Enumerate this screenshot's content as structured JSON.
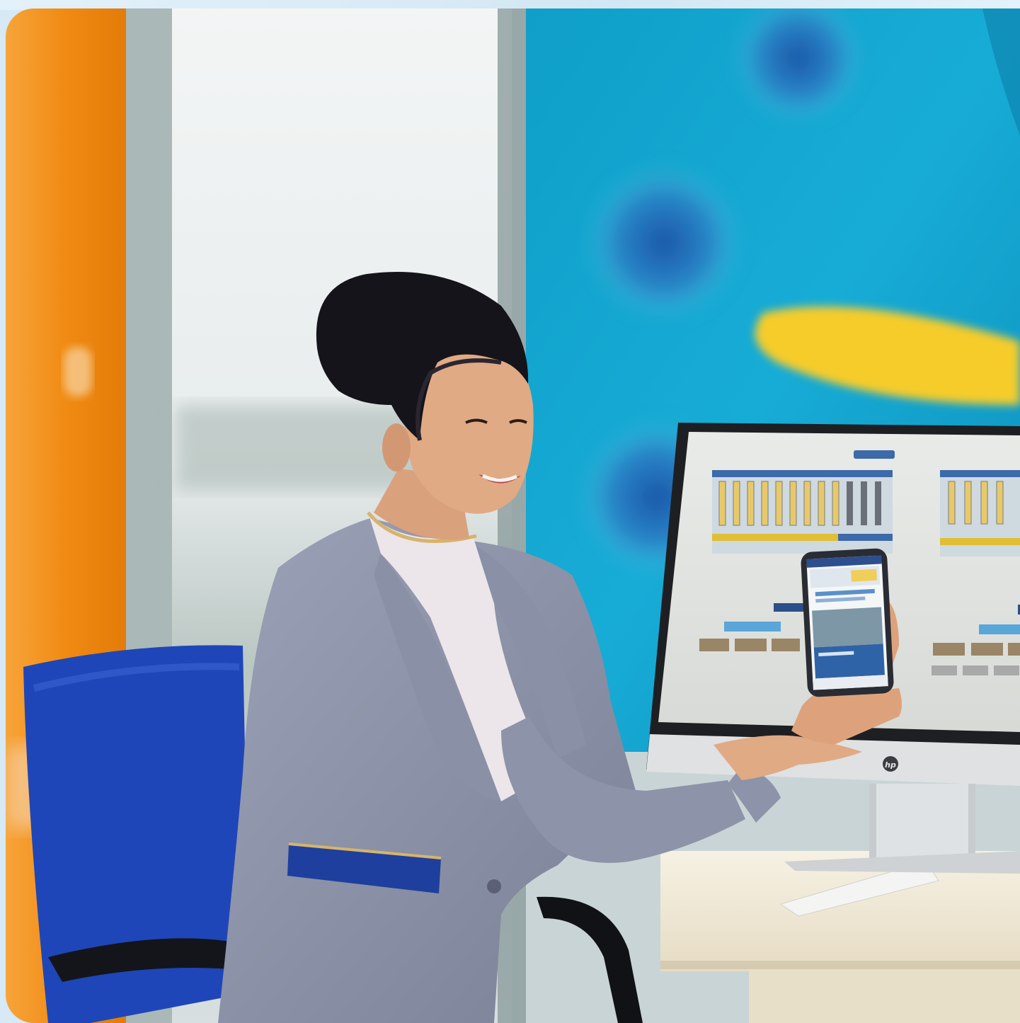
{
  "photo": {
    "subject": "woman-presenting-smartphone",
    "palette": {
      "orange_panel": "#f08a12",
      "window_glow": "#eef3f4",
      "teal_wall": "#12a6cf",
      "yellow_stripe": "#f5cc2a",
      "navy_blue": "#1f3fae",
      "suit_gray": "#8d93a8",
      "desk_cream": "#efe6d2",
      "hair": "#15141a",
      "skin": "#d9a27c"
    }
  },
  "monitor": {
    "brand_mark": "hp"
  }
}
